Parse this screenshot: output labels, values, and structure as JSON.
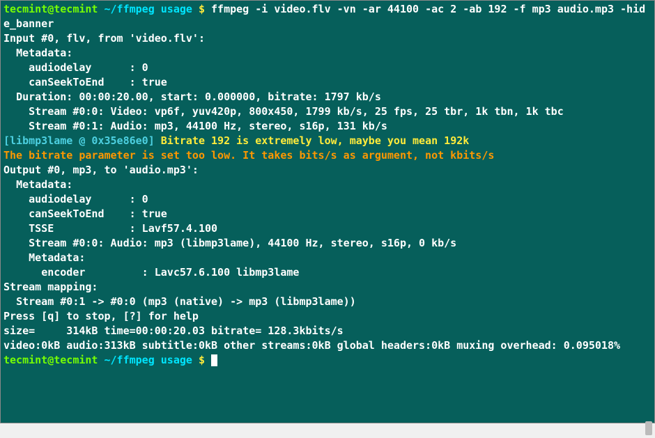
{
  "prompt1": {
    "user_host": "tecmint@tecmint",
    "path": "~/ffmpeg usage",
    "symbol": "$",
    "command": "ffmpeg -i video.flv -vn -ar 44100 -ac 2 -ab 192 -f mp3 audio.mp3 -hide_banner"
  },
  "output": {
    "line_input": "Input #0, flv, from 'video.flv':",
    "metadata_header": "  Metadata:",
    "audiodelay": "    audiodelay      : 0",
    "canseek": "    canSeekToEnd    : true",
    "duration": "  Duration: 00:00:20.00, start: 0.000000, bitrate: 1797 kb/s",
    "stream00": "    Stream #0:0: Video: vp6f, yuv420p, 800x450, 1799 kb/s, 25 fps, 25 tbr, 1k tbn, 1k tbc",
    "stream01": "    Stream #0:1: Audio: mp3, 44100 Hz, stereo, s16p, 131 kb/s",
    "libmp3lame_tag": "[libmp3lame @ 0x35e86e0]",
    "libmp3lame_msg": " Bitrate 192 is extremely low, maybe you mean 192k",
    "bitrate_warning": "The bitrate parameter is set too low. It takes bits/s as argument, not kbits/s",
    "output_header": "Output #0, mp3, to 'audio.mp3':",
    "out_metadata": "  Metadata:",
    "out_audiodelay": "    audiodelay      : 0",
    "out_canseek": "    canSeekToEnd    : true",
    "tsse": "    TSSE            : Lavf57.4.100",
    "out_stream00": "    Stream #0:0: Audio: mp3 (libmp3lame), 44100 Hz, stereo, s16p, 0 kb/s",
    "out_stream_meta": "    Metadata:",
    "encoder": "      encoder         : Lavc57.6.100 libmp3lame",
    "stream_mapping": "Stream mapping:",
    "mapping_detail": "  Stream #0:1 -> #0:0 (mp3 (native) -> mp3 (libmp3lame))",
    "press_q": "Press [q] to stop, [?] for help",
    "size_line": "size=     314kB time=00:00:20.03 bitrate= 128.3kbits/s",
    "video_line": "video:0kB audio:313kB subtitle:0kB other streams:0kB global headers:0kB muxing overhead: 0.095018%"
  },
  "prompt2": {
    "user_host": "tecmint@tecmint",
    "path": "~/ffmpeg usage",
    "symbol": "$"
  }
}
